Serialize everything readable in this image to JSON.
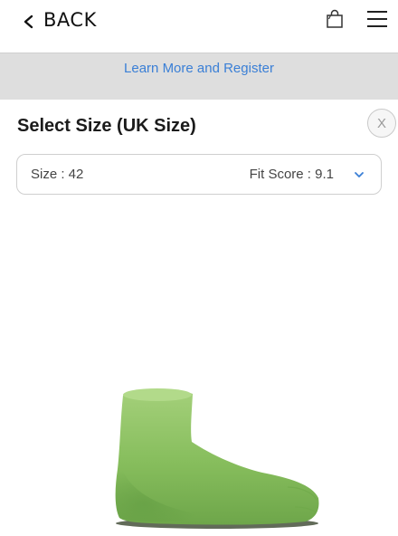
{
  "header": {
    "back_label": "BACK",
    "icons": [
      "chevron-left-icon",
      "shopping-bag-icon",
      "hamburger-menu-icon"
    ]
  },
  "banner": {
    "link_text": "Learn More and Register",
    "link_color": "#3a7fd6",
    "background": "#dedede"
  },
  "size_panel": {
    "title": "Select Size (UK Size)",
    "close_label": "X",
    "select": {
      "size_text": "Size : 42",
      "fit_score_text": "Fit Score : 9.1",
      "chevron_color": "#3a7fd6"
    }
  },
  "foot_model": {
    "description_icon": "foot-3d-model",
    "color": "#8cc063"
  }
}
